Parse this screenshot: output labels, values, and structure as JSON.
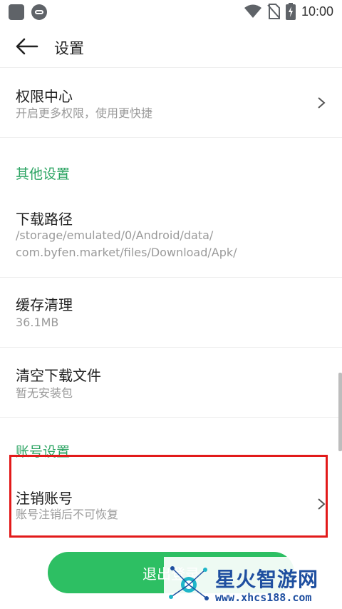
{
  "status_bar": {
    "time": "10:00",
    "icons": [
      "app-square-icon",
      "ca-circle-icon",
      "wifi-icon",
      "no-sim-icon",
      "battery-charging-icon"
    ]
  },
  "toolbar": {
    "title": "设置",
    "back_icon": "arrow-left-icon"
  },
  "permissions": {
    "title": "权限中心",
    "subtitle": "开启更多权限，使用更快捷"
  },
  "other_section": {
    "title": "其他设置"
  },
  "download_path": {
    "title": "下载路径",
    "line1": "/storage/emulated/0/Android/data/",
    "line2": "com.byfen.market/files/Download/Apk/"
  },
  "cache": {
    "title": "缓存清理",
    "subtitle": "36.1MB"
  },
  "clear_downloads": {
    "title": "清空下载文件",
    "subtitle": "暂无安装包"
  },
  "account_section": {
    "title": "账号设置"
  },
  "cancel_account": {
    "title": "注销账号",
    "subtitle": "账号注销后不可恢复"
  },
  "logout_button": {
    "label": "退出登录"
  },
  "watermark": {
    "title": "星火智游网",
    "url": "www.xhcs188.com"
  },
  "colors": {
    "accent_green": "#2aa361",
    "button_green": "#2dbf63",
    "highlight_red": "#e21a1a"
  }
}
